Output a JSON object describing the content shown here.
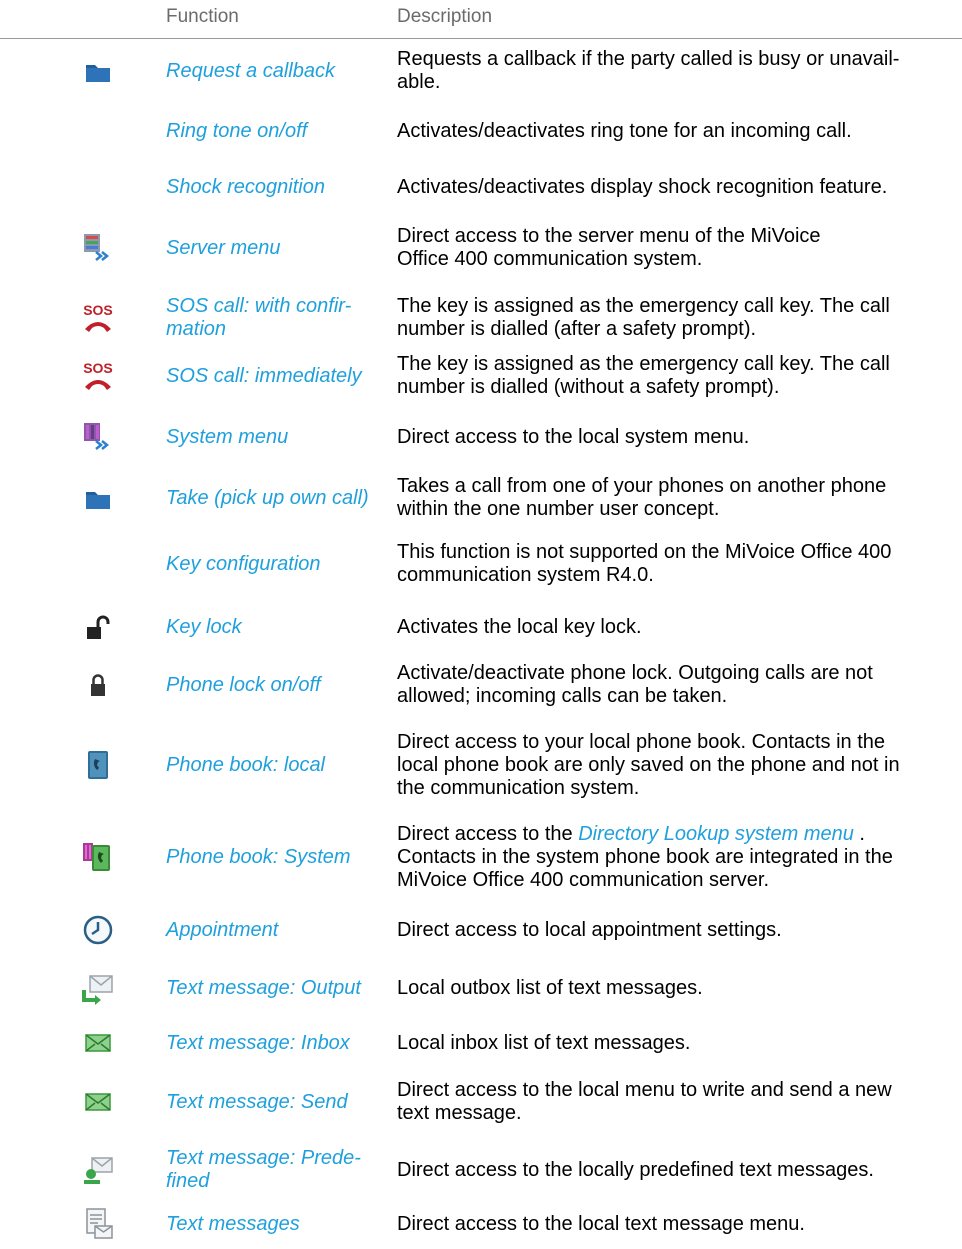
{
  "header": {
    "function": "Function",
    "description": "Description"
  },
  "rows": [
    {
      "icon": "folder-icon",
      "name": "Request a callback",
      "desc": "Requests a callback if the party called is busy or unavail-\nable."
    },
    {
      "icon": "",
      "name": "Ring tone on/off",
      "desc": "Activates/deactivates ring tone for an incoming call."
    },
    {
      "icon": "",
      "name": "Shock recognition",
      "desc": "Activates/deactivates display shock recognition feature."
    },
    {
      "icon": "server-menu-icon",
      "name": "Server menu",
      "desc": "Direct access to the server menu of the MiVoice\nOffice 400 communication system."
    },
    {
      "icon": "sos-icon",
      "name": "SOS call: with confir-\nmation",
      "desc": "The key is assigned as the emergency call key. The call\nnumber is dialled (after a safety prompt)."
    },
    {
      "icon": "sos-icon",
      "name": "SOS call: immediately",
      "desc": "The key is assigned as the emergency call key. The call\nnumber is dialled (without a safety prompt)."
    },
    {
      "icon": "system-menu-icon",
      "name": "System menu",
      "desc": "Direct access to the local system menu."
    },
    {
      "icon": "folder-icon",
      "name": "Take (pick up own call)",
      "desc": "Takes a call from one of your phones on another phone\nwithin the one number user concept."
    },
    {
      "icon": "",
      "name": "Key configuration",
      "desc": "This function is not supported on the MiVoice Office 400\ncommunication system R4.0."
    },
    {
      "icon": "unlock-icon",
      "name": "Key lock",
      "desc": "Activates the local key lock."
    },
    {
      "icon": "lock-icon",
      "name": "Phone lock on/off",
      "desc": "Activate/deactivate phone lock. Outgoing calls are not\nallowed; incoming calls can be taken."
    },
    {
      "icon": "phone-book-icon",
      "name": "Phone book: local",
      "desc": "Direct access to your local phone book. Contacts in the\nlocal phone book are only saved on the phone and not in\nthe communication system."
    },
    {
      "icon": "system-phone-book-icon",
      "name": "Phone book: System",
      "desc_before": "Direct access to the ",
      "desc_link": "Directory Lookup system menu",
      "desc_after": " .\nContacts in the system phone book are integrated in the\nMiVoice Office 400 communication server."
    },
    {
      "icon": "clock-icon",
      "name": "Appointment",
      "desc": "Direct access to local appointment settings."
    },
    {
      "icon": "outbox-icon",
      "name": "Text message: Output",
      "desc": "Local outbox list of text messages."
    },
    {
      "icon": "envelope-icon",
      "name": "Text message: Inbox",
      "desc": "Local inbox list of text messages."
    },
    {
      "icon": "envelope-icon",
      "name": "Text message: Send",
      "desc": "Direct access to the local menu to write and send a new\ntext message."
    },
    {
      "icon": "predefined-message-icon",
      "name": "Text message: Prede-\nfined",
      "desc": "Direct access to the locally predefined text messages."
    },
    {
      "icon": "text-messages-icon",
      "name": "Text messages",
      "desc": "Direct access to the local text message menu."
    }
  ]
}
